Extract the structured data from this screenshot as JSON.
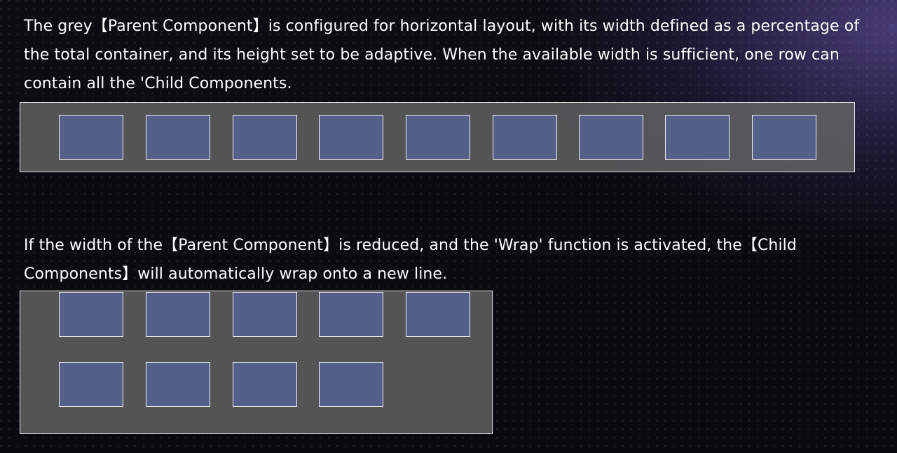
{
  "section_1": {
    "text": "The grey【Parent Component】is configured for horizontal layout, with its width defined as a percentage of the total container, and its height set to be adaptive. When the available width is sufficient, one row can contain all the 'Child Components."
  },
  "section_2": {
    "text": "If the width of the【Parent Component】is reduced, and the 'Wrap' function is activated, the【Child Components】will automatically wrap onto a new line."
  },
  "colors": {
    "parent_fill": "#696969",
    "parent_border": "#e8e8e8",
    "child_fill": "#55608a",
    "child_border": "#f0f0f0",
    "background": "#0b0b0f",
    "accent_glow": "#7864c8"
  },
  "diagram": {
    "single_row_child_count": 9,
    "wrapped_rows": [
      5,
      4
    ]
  }
}
